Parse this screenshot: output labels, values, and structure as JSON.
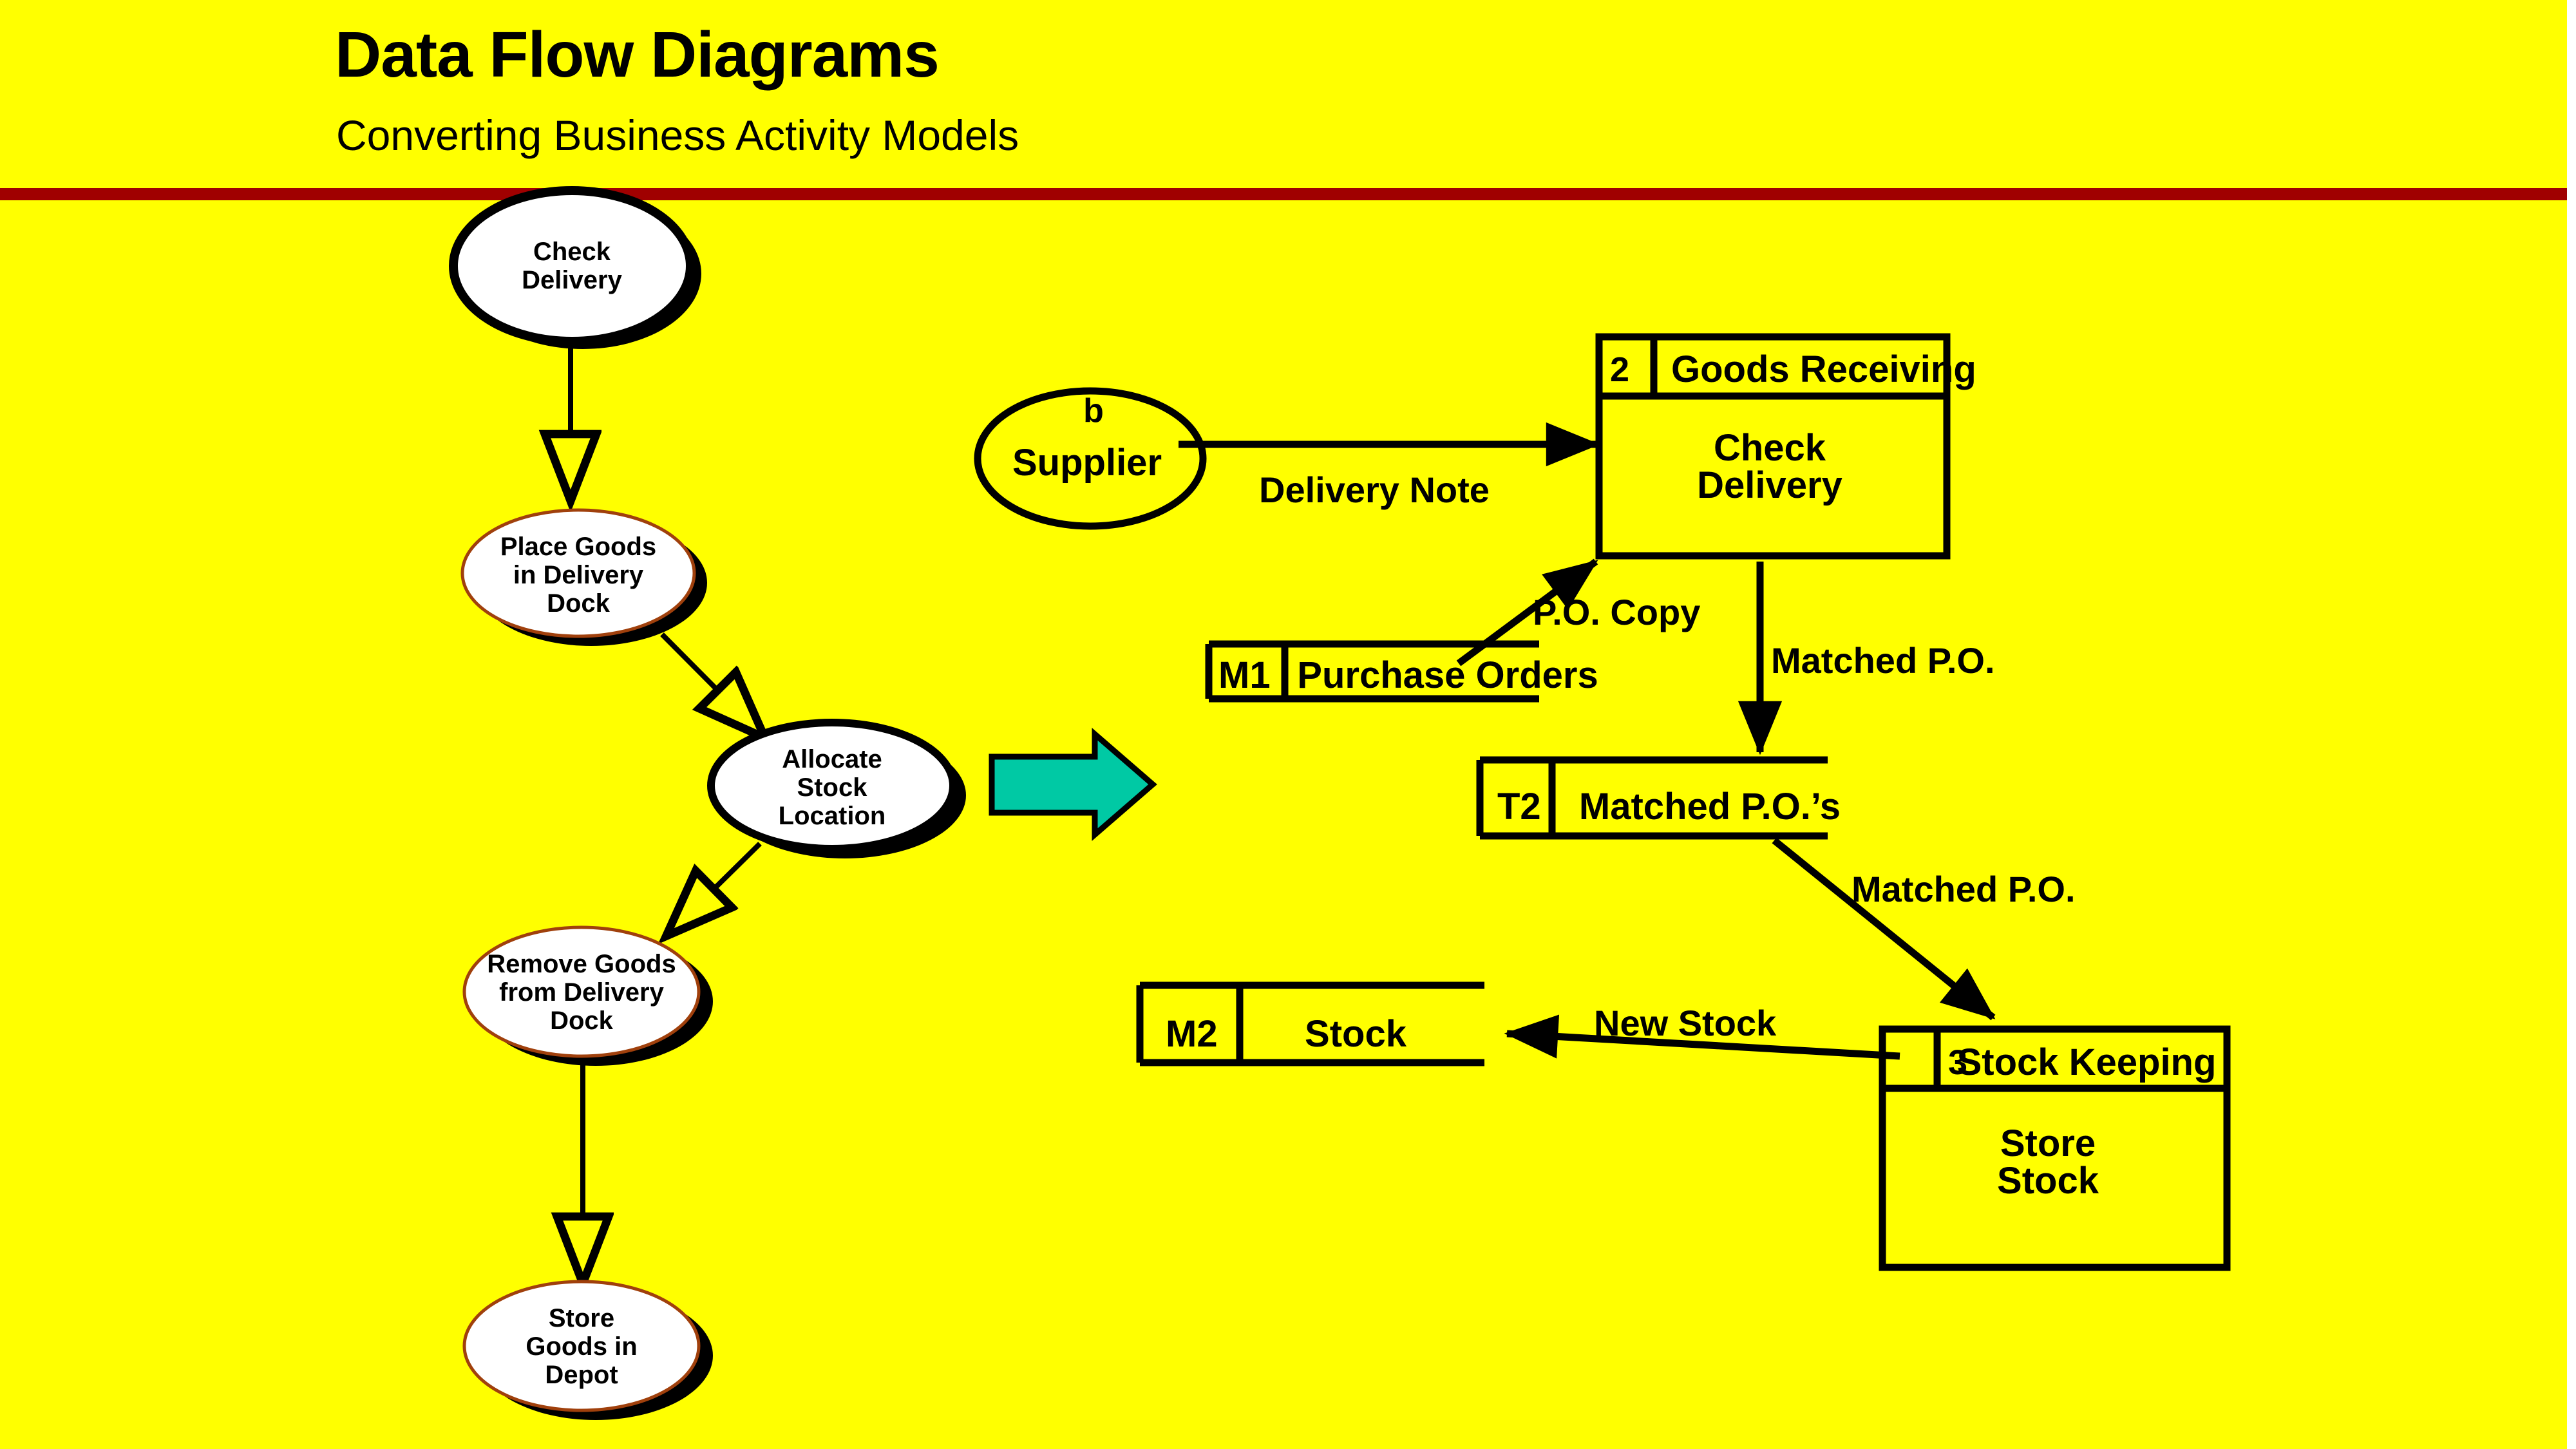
{
  "slide": {
    "title": "Data Flow Diagrams",
    "subtitle": "Converting Business Activity Models",
    "background_color": "#FFFF00",
    "divider_color": "#A00000"
  },
  "bam": {
    "description": "Business Activity Model — sequence of activity ovals on the left",
    "activities": [
      {
        "id": "check-delivery",
        "lines": [
          "Check",
          "Delivery"
        ],
        "border_color": "#000000",
        "border_width": 14,
        "fill": "#FFFFFF"
      },
      {
        "id": "place-goods-in-delivery-dock",
        "lines": [
          "Place Goods",
          "in Delivery",
          "Dock"
        ],
        "border_color": "#A0400C",
        "border_width": 5,
        "fill": "#FFFFFF"
      },
      {
        "id": "allocate-stock-location",
        "lines": [
          "Allocate",
          "Stock",
          "Location"
        ],
        "border_color": "#000000",
        "border_width": 12,
        "fill": "#FFFFFF"
      },
      {
        "id": "remove-goods-from-delivery-dock",
        "lines": [
          "Remove Goods",
          "from Delivery",
          "Dock"
        ],
        "border_color": "#A0400C",
        "border_width": 5,
        "fill": "#FFFFFF"
      },
      {
        "id": "store-goods-in-depot",
        "lines": [
          "Store",
          "Goods in",
          "Depot"
        ],
        "border_color": "#A0400C",
        "border_width": 5,
        "fill": "#FFFFFF"
      }
    ],
    "connectors": [
      {
        "from": "check-delivery",
        "to": "place-goods-in-delivery-dock",
        "arrowhead": "hollow"
      },
      {
        "from": "place-goods-in-delivery-dock",
        "to": "allocate-stock-location",
        "arrowhead": "hollow"
      },
      {
        "from": "allocate-stock-location",
        "to": "remove-goods-from-delivery-dock",
        "arrowhead": "hollow"
      },
      {
        "from": "remove-goods-from-delivery-dock",
        "to": "store-goods-in-depot",
        "arrowhead": "hollow"
      }
    ]
  },
  "transform_arrow": {
    "name": "converts-to-arrow",
    "fill": "#00C9A4",
    "stroke": "#000000",
    "direction": "right"
  },
  "dfd": {
    "description": "Data Flow Diagram produced from the Business Activity Model",
    "external_entities": [
      {
        "id": "b",
        "name": "Supplier"
      }
    ],
    "processes": [
      {
        "id": "2",
        "title": "Goods Receiving",
        "body_lines": [
          "Check",
          "Delivery"
        ]
      },
      {
        "id": "3",
        "title": "Stock Keeping",
        "body_lines": [
          "Store",
          "Stock"
        ]
      }
    ],
    "data_stores": [
      {
        "id": "M1",
        "name": "Purchase Orders"
      },
      {
        "id": "T2",
        "name": "Matched P.O.’s"
      },
      {
        "id": "M2",
        "name": "Stock"
      }
    ],
    "flows": [
      {
        "id": "delivery-note",
        "label": "Delivery Note",
        "from": "b",
        "to": "2",
        "arrowhead": "filled"
      },
      {
        "id": "po-copy",
        "label": "P.O. Copy",
        "from": "M1",
        "to": "2",
        "arrowhead": "filled"
      },
      {
        "id": "matched-po-to-t2",
        "label": "Matched P.O.",
        "from": "2",
        "to": "T2",
        "arrowhead": "filled"
      },
      {
        "id": "matched-po-to-3",
        "label": "Matched P.O.",
        "from": "T2",
        "to": "3",
        "arrowhead": "filled"
      },
      {
        "id": "new-stock",
        "label": "New Stock",
        "from": "3",
        "to": "M2",
        "arrowhead": "filled"
      }
    ]
  }
}
